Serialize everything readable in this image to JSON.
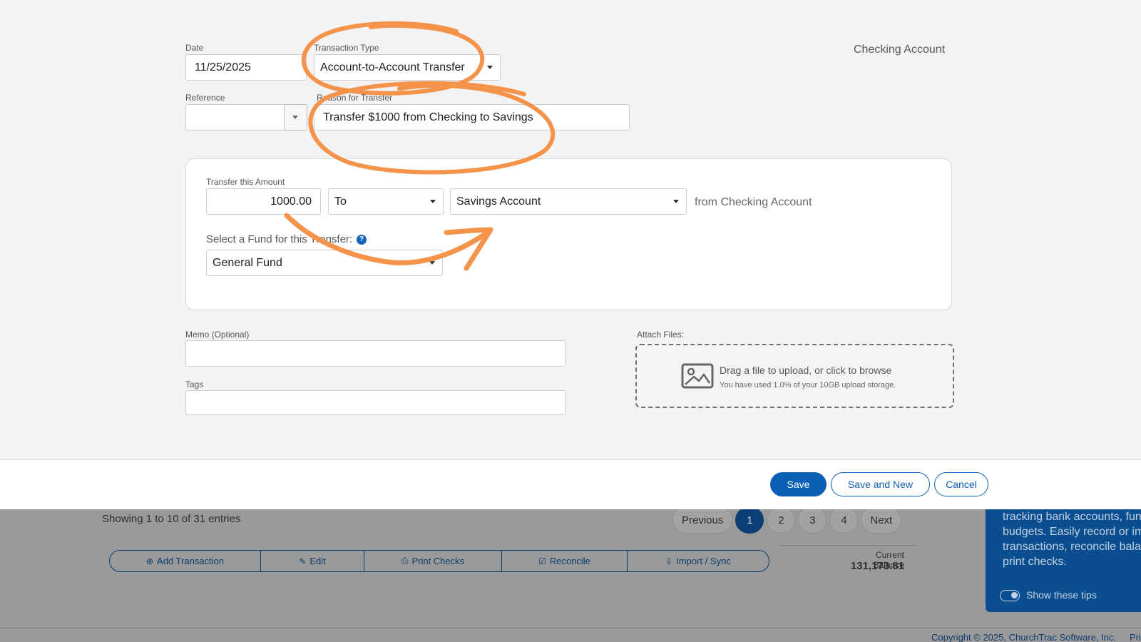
{
  "form": {
    "account_title": "Checking Account",
    "date": {
      "label": "Date",
      "value": "11/25/2025"
    },
    "transaction_type": {
      "label": "Transaction Type",
      "value": "Account-to-Account Transfer"
    },
    "reference": {
      "label": "Reference",
      "value": ""
    },
    "reason": {
      "label": "Reason for Transfer",
      "value": "Transfer $1000 from Checking to Savings"
    },
    "transfer": {
      "amount_label": "Transfer this Amount",
      "amount": "1000.00",
      "direction": "To",
      "account": "Savings Account",
      "from_text": "from Checking Account",
      "fund_prompt": "Select a Fund for this Transfer:",
      "fund": "General Fund"
    },
    "memo": {
      "label": "Memo (Optional)",
      "value": ""
    },
    "tags": {
      "label": "Tags",
      "value": ""
    },
    "attach": {
      "label": "Attach Files:",
      "main": "Drag a file to upload, or click to browse",
      "sub": "You have used 1.0% of your 10GB upload storage."
    }
  },
  "footer": {
    "save": "Save",
    "save_new": "Save and New",
    "cancel": "Cancel"
  },
  "background": {
    "entries": "Showing 1 to 10 of 31 entries",
    "pagination": [
      "Previous",
      "1",
      "2",
      "3",
      "4",
      "Next"
    ],
    "active_page": "1",
    "actions": [
      {
        "label": "Add Transaction",
        "icon": "plus-circle-icon"
      },
      {
        "label": "Edit",
        "icon": "edit-icon"
      },
      {
        "label": "Print Checks",
        "icon": "printer-icon"
      },
      {
        "label": "Reconcile",
        "icon": "checkbox-icon"
      },
      {
        "label": "Import / Sync",
        "icon": "import-icon"
      }
    ],
    "balance_label": "Current Balance",
    "balance_value": "131,173.81",
    "tips": {
      "text": "tracking bank accounts, fun budgets. Easily record or im transactions, reconcile bala print checks.",
      "toggle_label": "Show these tips"
    },
    "copyright": "Copyright © 2025, ChurchTrac Software, Inc.",
    "copyright_extra": "Pri"
  },
  "colors": {
    "primary": "#0b5fb4",
    "annotation": "#f5934a",
    "modal_bg": "#f3f3f3",
    "page_dim": "#9a9a9a",
    "tips_bg": "#0b4e8f"
  }
}
